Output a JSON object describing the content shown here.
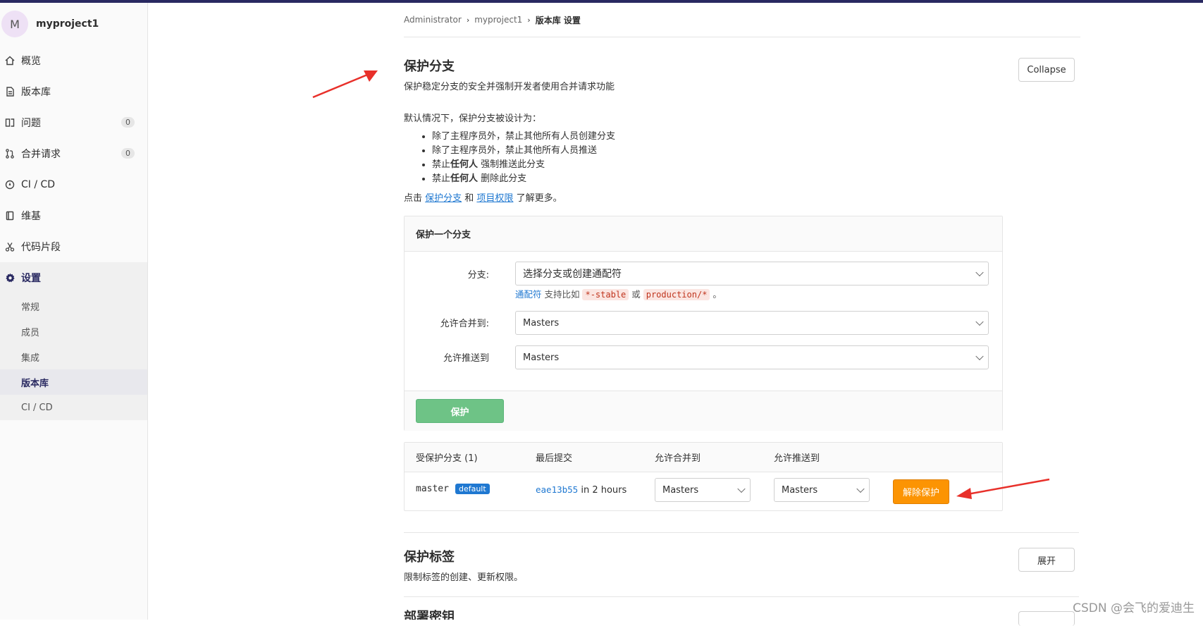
{
  "sidebar": {
    "avatar_letter": "M",
    "project_name": "myproject1",
    "items": [
      {
        "label": "概览",
        "icon": "home-icon"
      },
      {
        "label": "版本库",
        "icon": "document-icon"
      },
      {
        "label": "问题",
        "icon": "issues-icon",
        "count": "0"
      },
      {
        "label": "合并请求",
        "icon": "merge-request-icon",
        "count": "0"
      },
      {
        "label": "CI / CD",
        "icon": "rocket-icon"
      },
      {
        "label": "维基",
        "icon": "book-icon"
      },
      {
        "label": "代码片段",
        "icon": "scissors-icon"
      },
      {
        "label": "设置",
        "icon": "gear-icon"
      }
    ],
    "settings_sub": [
      "常规",
      "成员",
      "集成",
      "版本库",
      "CI / CD"
    ]
  },
  "breadcrumb": [
    "Administrator",
    "myproject1",
    "版本库 设置"
  ],
  "protect_branches": {
    "title": "保护分支",
    "description": "保护稳定分支的安全并强制开发者使用合并请求功能",
    "collapse_label": "Collapse",
    "default_intro": "默认情况下，保护分支被设计为：",
    "rules": [
      {
        "pre": "除了主程序员外，禁止其他所有人员创建分支",
        "bold": "",
        "post": ""
      },
      {
        "pre": "除了主程序员外，禁止其他所有人员推送",
        "bold": "",
        "post": ""
      },
      {
        "pre": "禁止",
        "bold": "任何人",
        "post": " 强制推送此分支"
      },
      {
        "pre": "禁止",
        "bold": "任何人",
        "post": " 删除此分支"
      }
    ],
    "learn_more_pre": "点击 ",
    "learn_more_link1": "保护分支",
    "learn_more_mid": " 和 ",
    "learn_more_link2": "项目权限",
    "learn_more_post": " 了解更多。",
    "form": {
      "title": "保护一个分支",
      "branch_label": "分支:",
      "branch_placeholder": "选择分支或创建通配符",
      "hint_link": "通配符",
      "hint_text1": " 支持比如 ",
      "hint_code1": "*-stable",
      "hint_text2": " 或 ",
      "hint_code2": "production/*",
      "hint_text3": " 。",
      "merge_label": "允许合并到:",
      "merge_value": "Masters",
      "push_label": "允许推送到",
      "push_value": "Masters",
      "protect_button": "保护"
    },
    "table": {
      "headers": [
        "受保护分支 (1)",
        "最后提交",
        "允许合并到",
        "允许推送到"
      ],
      "rows": [
        {
          "branch": "master",
          "badge": "default",
          "commit_hash": "eae13b55",
          "commit_time": " in 2 hours",
          "merge": "Masters",
          "push": "Masters",
          "unprotect_label": "解除保护"
        }
      ]
    }
  },
  "protect_tags": {
    "title": "保护标签",
    "description": "限制标签的创建、更新权限。",
    "expand_label": "展开"
  },
  "next_section_title": "部署密钥",
  "watermark": "CSDN @会飞的爱迪生",
  "colors": {
    "accent_arrow": "#e8302a",
    "protect_green": "#6ec386",
    "unprotect_orange": "#fc9403",
    "link_blue": "#1f78d1"
  }
}
